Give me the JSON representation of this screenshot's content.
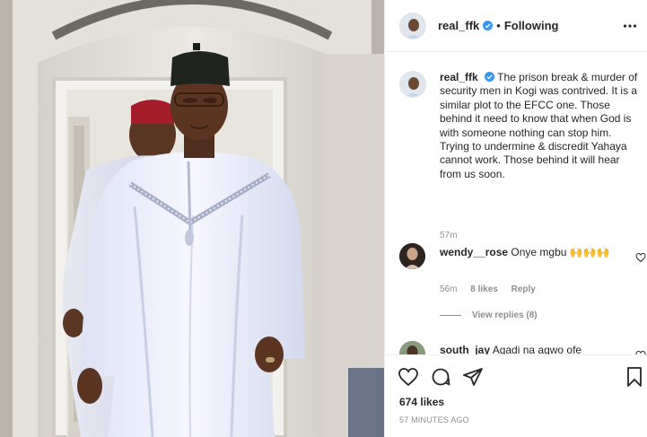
{
  "post": {
    "author": "real_ffk",
    "follow_status": "Following",
    "separator": "•",
    "caption": "The prison break & murder of security men in Kogi was contrived. It is a similar plot to the EFCC one. Those behind it need to know that when God is with someone nothing can stop him. Trying to undermine & discredit Yahaya cannot work. Those behind it will hear from us soon.",
    "caption_time": "57m",
    "likes": "674 likes",
    "posted_ago": "57 MINUTES AGO"
  },
  "comments": [
    {
      "username": "wendy__rose",
      "text": "Onye mgbu 🙌🙌🙌",
      "time": "56m",
      "likes": "8 likes",
      "reply_label": "Reply",
      "view_replies": "View replies (8)"
    },
    {
      "username": "south_jay",
      "text": "Agadi na agwo ofe"
    }
  ],
  "icons": {
    "verified": "verified-badge-icon",
    "more": "more-options-icon",
    "like": "heart-icon",
    "comment": "comment-icon",
    "share": "paper-plane-icon",
    "save": "bookmark-icon"
  },
  "colors": {
    "accent_blue": "#3897f0",
    "text": "#262626",
    "muted": "#8e8e8e",
    "divider": "#efefef"
  }
}
